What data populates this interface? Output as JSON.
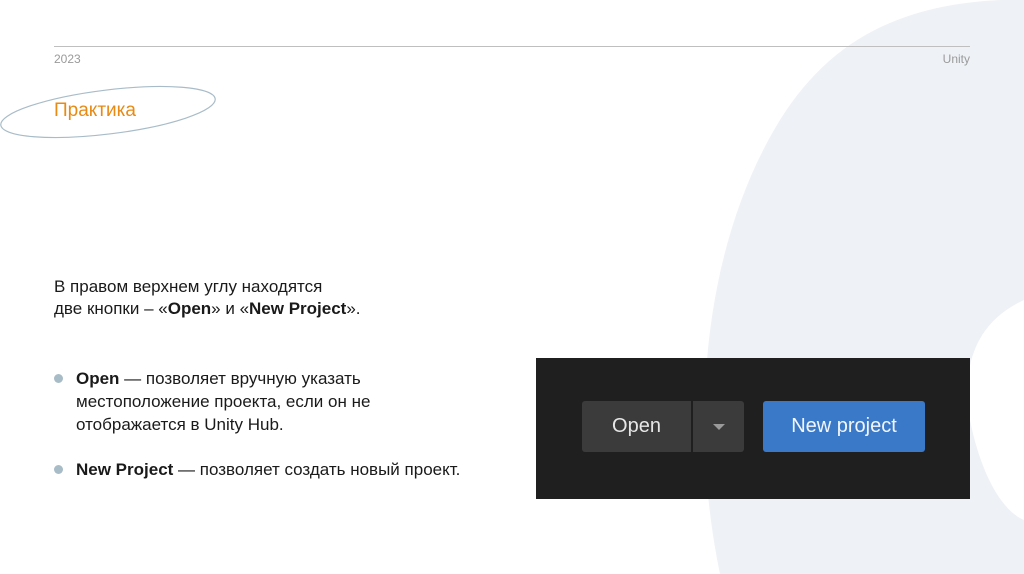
{
  "header": {
    "year": "2023",
    "brand": "Unity"
  },
  "section": {
    "title": "Практика"
  },
  "intro": {
    "line1": "В правом верхнем углу находятся",
    "line2_start": "две кнопки – «",
    "open_label": "Open",
    "line2_mid": "» и «",
    "new_project_label": "New Project",
    "line2_end": "»."
  },
  "bullets": [
    {
      "term": "Open",
      "dash": " — ",
      "text": " позволяет вручную указать местоположение проекта, если он не отображается в Unity Hub."
    },
    {
      "term": "New Project",
      "dash": " — ",
      "text": " позволяет создать новый проект."
    }
  ],
  "screenshot": {
    "open_button": "Open",
    "new_project_button": "New project"
  },
  "colors": {
    "accent": "#e88a13",
    "panel": "#1f1f1f",
    "button_dark": "#3b3b3b",
    "button_blue": "#3a78c8",
    "bullet_dot": "#a8bcc8"
  }
}
